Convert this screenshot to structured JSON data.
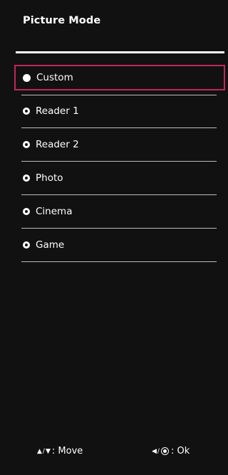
{
  "header": {
    "title": "Picture Mode"
  },
  "menu": {
    "items": [
      {
        "label": "Custom",
        "selected": true
      },
      {
        "label": "Reader 1",
        "selected": false
      },
      {
        "label": "Reader 2",
        "selected": false
      },
      {
        "label": "Photo",
        "selected": false
      },
      {
        "label": "Cinema",
        "selected": false
      },
      {
        "label": "Game",
        "selected": false
      }
    ]
  },
  "footer": {
    "move_glyph_up": "▲",
    "move_separator": "/",
    "move_glyph_down": "▼",
    "move_label": ": Move",
    "ok_glyph_left": "◀",
    "ok_separator": "/",
    "ok_label": ": Ok"
  },
  "colors": {
    "background": "#111111",
    "highlight": "#c3265a",
    "text": "#ffffff"
  },
  "icons": {
    "selected_radio": "radio-filled-icon",
    "unselected_radio": "radio-empty-icon",
    "up_arrow": "up-arrow-icon",
    "down_arrow": "down-arrow-icon",
    "left_arrow": "left-arrow-icon",
    "ok_button": "joystick-ok-icon"
  }
}
